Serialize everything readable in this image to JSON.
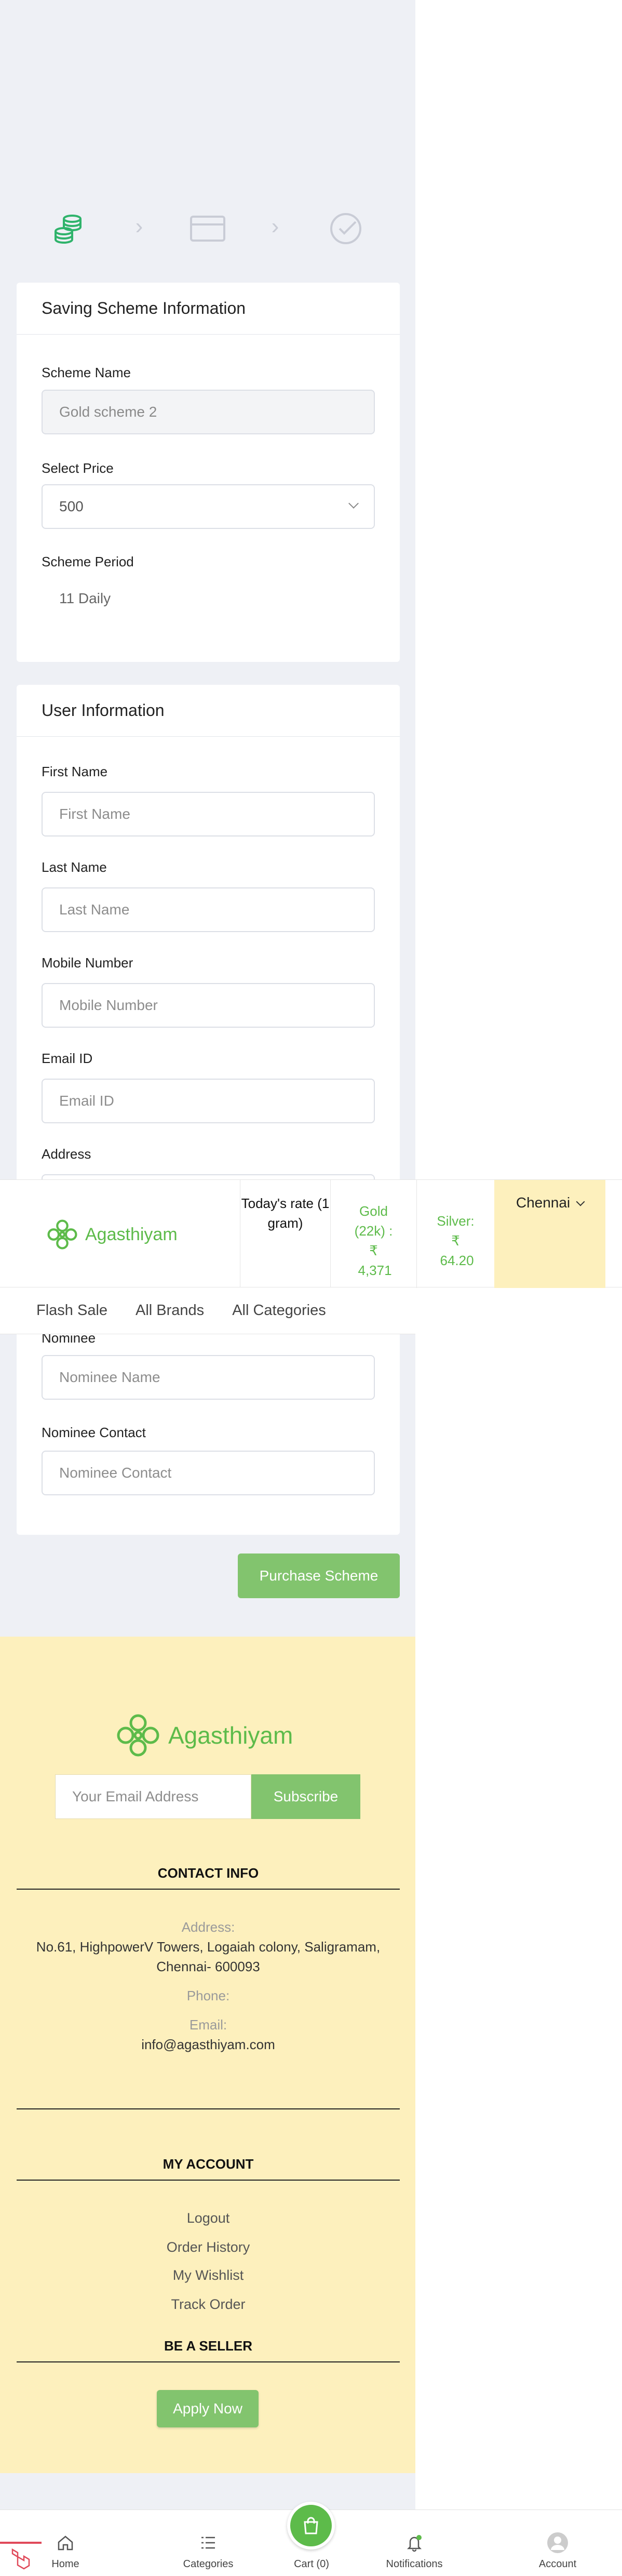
{
  "brand": {
    "name": "Agasthiyam",
    "accent": "#5dbb4a",
    "button_green": "#82c46e",
    "footer_bg": "#fdf0bd"
  },
  "stepper": {
    "steps": [
      "coins-icon",
      "card-icon",
      "check-circle-icon"
    ]
  },
  "scheme_card": {
    "title": "Saving Scheme Information",
    "scheme_name_label": "Scheme Name",
    "scheme_name_value": "Gold scheme 2",
    "select_price_label": "Select Price",
    "select_price_value": "500",
    "scheme_period_label": "Scheme Period",
    "scheme_period_value": "11 Daily"
  },
  "user_card": {
    "title": "User Information",
    "first_name_label": "First Name",
    "first_name_placeholder": "First Name",
    "last_name_label": "Last Name",
    "last_name_placeholder": "Last Name",
    "mobile_label": "Mobile Number",
    "mobile_placeholder": "Mobile Number",
    "email_label": "Email ID",
    "email_placeholder": "Email ID",
    "address_label": "Address",
    "nominee_label": "Nominee",
    "nominee_placeholder": "Nominee Name",
    "nominee_contact_label": "Nominee Contact",
    "nominee_contact_placeholder": "Nominee Contact"
  },
  "purchase_button": "Purchase Scheme",
  "header": {
    "rate_title": "Today's rate (1 gram)",
    "gold_label": "Gold (22k) :",
    "gold_value": "₹ 4,371",
    "silver_label": "Silver:",
    "silver_value": "₹ 64.20",
    "city": "Chennai"
  },
  "nav": {
    "items": [
      "Flash Sale",
      "All Brands",
      "All Categories"
    ]
  },
  "footer": {
    "email_placeholder": "Your Email Address",
    "subscribe": "Subscribe",
    "contact_heading": "CONTACT INFO",
    "address_label": "Address:",
    "address_value": "No.61, HighpowerV Towers, Logaiah colony, Saligramam, Chennai- 600093",
    "phone_label": "Phone:",
    "email_label": "Email:",
    "email_value": "info@agasthiyam.com",
    "account_heading": "MY ACCOUNT",
    "account_links": [
      "Logout",
      "Order History",
      "My Wishlist",
      "Track Order"
    ],
    "seller_heading": "BE A SELLER",
    "apply_now": "Apply Now"
  },
  "tabbar": {
    "home": "Home",
    "categories": "Categories",
    "cart": "Cart (0)",
    "notifications": "Notifications",
    "account": "Account"
  }
}
